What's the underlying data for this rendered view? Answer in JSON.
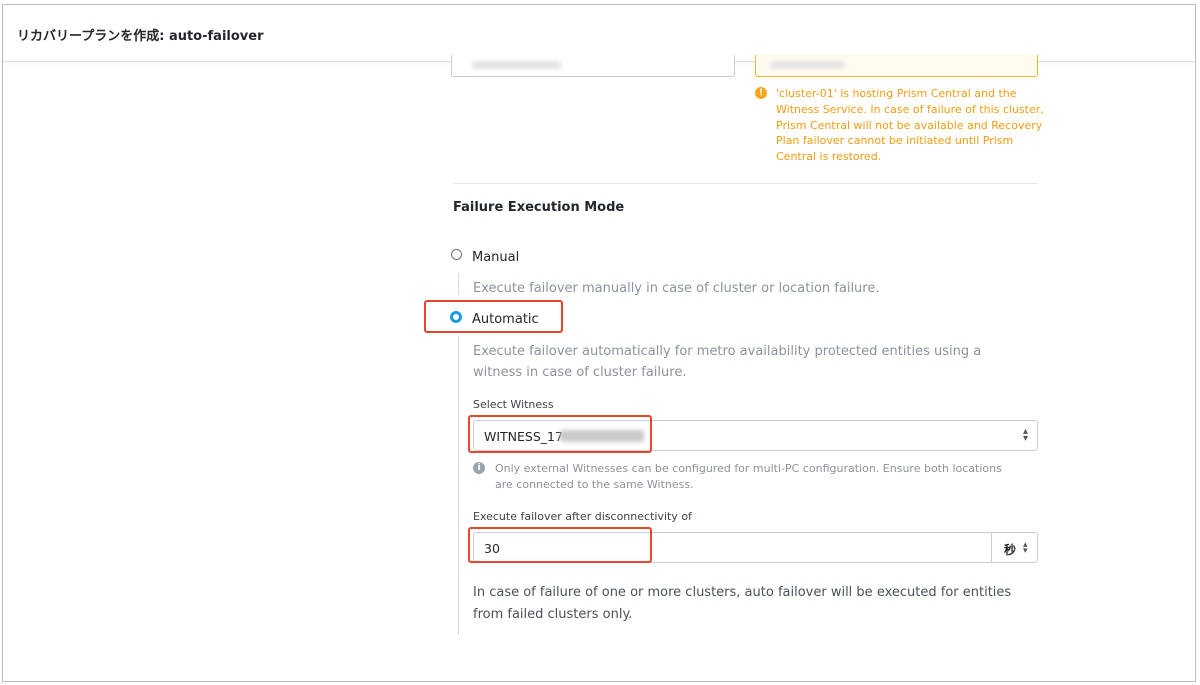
{
  "window": {
    "title": "リカバリープランを作成: auto-failover"
  },
  "warning": {
    "text": "'cluster-01' is hosting Prism Central and the Witness Service. In case of failure of this cluster, Prism Central will not be available and Recovery Plan failover cannot be initiated until Prism Central is restored."
  },
  "failure_mode": {
    "title": "Failure Execution Mode",
    "options": [
      {
        "label": "Manual",
        "selected": false,
        "description": "Execute failover manually in case of cluster or location failure."
      },
      {
        "label": "Automatic",
        "selected": true,
        "description": "Execute failover automatically for metro availability protected entities using a witness in case of cluster failure."
      }
    ]
  },
  "witness": {
    "label": "Select Witness",
    "selected_value": "WITNESS_17",
    "info": "Only external Witnesses can be configured for multi-PC configuration. Ensure both locations are connected to the same Witness."
  },
  "disconnect": {
    "label": "Execute failover after disconnectivity of",
    "value": "30",
    "unit": "秒"
  },
  "note": {
    "text": "In case of failure of one or more clusters, auto failover will be executed for entities from failed clusters only."
  },
  "colors": {
    "accent": "#1b9ce0",
    "warning": "#f29c11",
    "highlight": "#e8462a"
  }
}
